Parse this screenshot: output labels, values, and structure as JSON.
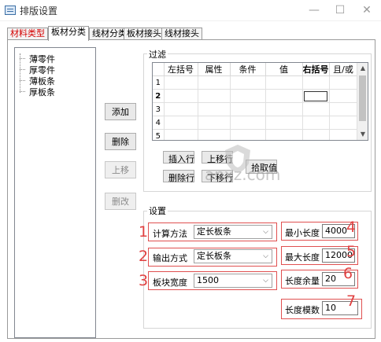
{
  "window": {
    "title": "排版设置",
    "controls": [
      "—",
      "☐",
      "✕"
    ]
  },
  "tabs": [
    {
      "label": "材料类型",
      "active": false,
      "color": "#d40000"
    },
    {
      "label": "板材分类",
      "active": true
    },
    {
      "label": "线材分类",
      "active": false
    },
    {
      "label": "板材接头",
      "active": false
    },
    {
      "label": "线材接头",
      "active": false
    }
  ],
  "tree": {
    "items": [
      "薄零件",
      "厚零件",
      "薄板条",
      "厚板条"
    ]
  },
  "side_buttons": {
    "add": "添加",
    "delete": "删除",
    "move_up": "上移",
    "move_down": "删改"
  },
  "filter": {
    "label": "过滤",
    "columns": [
      "左括号",
      "属性",
      "条件",
      "值",
      "右括号",
      "且/或"
    ],
    "rows": [
      "1",
      "2",
      "3",
      "4",
      "5"
    ],
    "buttons": {
      "insert_row": "插入行",
      "delete_row": "删除行",
      "move_up_row": "上移行",
      "move_down_row": "下移行",
      "pick_value": "拾取值"
    }
  },
  "settings": {
    "label": "设置",
    "calc_method": {
      "label": "计算方法",
      "value": "定长板条"
    },
    "output_method": {
      "label": "输出方式",
      "value": "定长板条"
    },
    "block_width": {
      "label": "板块宽度",
      "value": "1500"
    },
    "min_length": {
      "label": "最小长度",
      "value": "4000"
    },
    "max_length": {
      "label": "最大长度",
      "value": "12000"
    },
    "length_margin": {
      "label": "长度余量",
      "value": "20"
    },
    "length_modulus": {
      "label": "长度模数",
      "value": "10"
    }
  },
  "annotations": [
    "1",
    "2",
    "3",
    "4",
    "5",
    "6",
    "7"
  ],
  "watermark": {
    "text": "anxz.com"
  }
}
